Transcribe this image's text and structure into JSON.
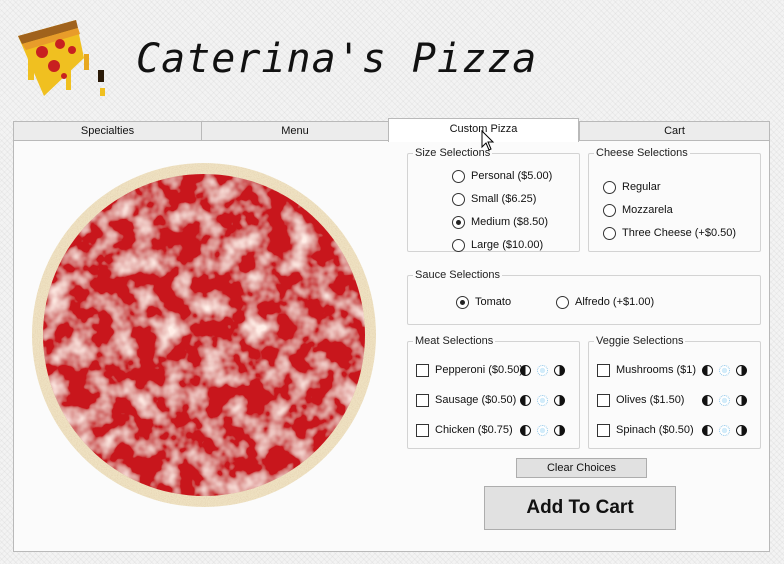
{
  "app": {
    "title": "Caterina's Pizza"
  },
  "tabs": [
    {
      "label": "Specialties"
    },
    {
      "label": "Menu"
    },
    {
      "label": "Custom Pizza",
      "selected": true
    },
    {
      "label": "Cart"
    }
  ],
  "size_selections": {
    "legend": "Size Selections",
    "options": [
      {
        "label": "Personal ($5.00)",
        "checked": false
      },
      {
        "label": "Small ($6.25)",
        "checked": false
      },
      {
        "label": "Medium ($8.50)",
        "checked": true
      },
      {
        "label": "Large ($10.00)",
        "checked": false
      }
    ]
  },
  "cheese_selections": {
    "legend": "Cheese Selections",
    "options": [
      {
        "label": "Regular",
        "checked": false
      },
      {
        "label": "Mozzarela",
        "checked": false
      },
      {
        "label": "Three Cheese (+$0.50)",
        "checked": false
      }
    ]
  },
  "sauce_selections": {
    "legend": "Sauce Selections",
    "options": [
      {
        "label": "Tomato",
        "checked": true
      },
      {
        "label": "Alfredo (+$1.00)",
        "checked": false
      }
    ]
  },
  "meat_selections": {
    "legend": "Meat Selections",
    "items": [
      {
        "label": "Pepperoni ($0.50)",
        "checked": false
      },
      {
        "label": "Sausage ($0.50)",
        "checked": false
      },
      {
        "label": "Chicken ($0.75)",
        "checked": false
      }
    ]
  },
  "veggie_selections": {
    "legend": "Veggie Selections",
    "items": [
      {
        "label": "Mushrooms ($1)",
        "checked": false
      },
      {
        "label": "Olives ($1.50)",
        "checked": false
      },
      {
        "label": "Spinach ($0.50)",
        "checked": false
      }
    ]
  },
  "actions": {
    "clear_label": "Clear Choices",
    "add_label": "Add To Cart"
  },
  "icons": {
    "logo": "pizza-slice-icon",
    "portion_left": "left-half-icon",
    "portion_whole": "whole-pizza-icon",
    "portion_right": "right-half-icon",
    "cursor": "mouse-pointer-icon"
  },
  "colors": {
    "sauce": "#c8141e",
    "crust": "#efe2c2",
    "window_bg": "#f3f3f3"
  }
}
